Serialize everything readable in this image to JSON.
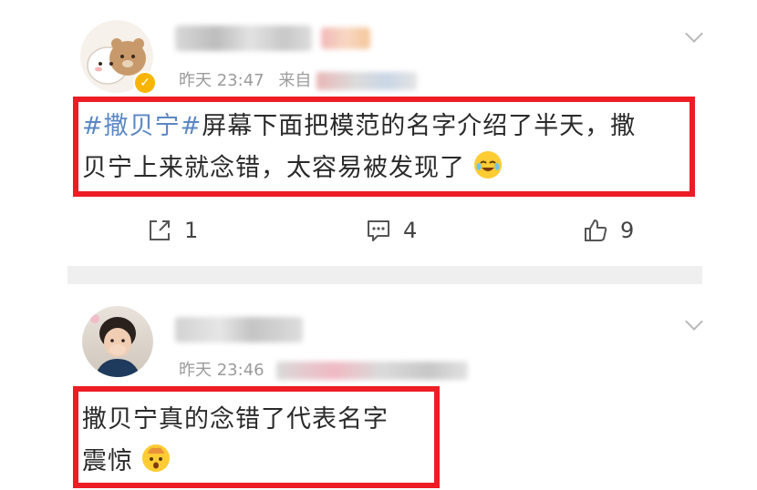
{
  "posts": [
    {
      "time": "昨天 23:47",
      "source_prefix": "来自",
      "text_hashtag": "#撒贝宁#",
      "text_line1_rest": "屏幕下面把模范的名字介绍了半天，撒",
      "text_line2": "贝宁上来就念错，太容易被发现了",
      "repost_count": "1",
      "comment_count": "4",
      "like_count": "9"
    },
    {
      "time": "昨天 23:46",
      "text_line1": "撒贝宁真的念错了代表名字",
      "text_line2": "震惊"
    }
  ],
  "icons": {
    "verified": "verified-badge-icon",
    "more": "chevron-down-icon",
    "repost": "share-icon",
    "comment": "comment-icon",
    "like": "thumbs-up-icon"
  },
  "colors": {
    "hashtag": "#5b87c4",
    "highlight_box": "#ee1c25",
    "meta": "#9b9b9b",
    "separator": "#efefef"
  }
}
